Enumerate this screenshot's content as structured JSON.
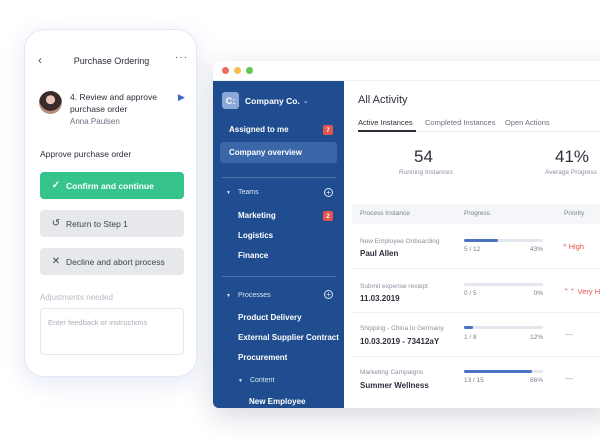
{
  "window": {
    "sidebar": {
      "company_logo": "C:",
      "company_name": "Company Co.",
      "caret_icon": "chevron-down-icon",
      "items": [
        {
          "label": "Assigned to me",
          "badge": "7"
        },
        {
          "label": "Company overview"
        }
      ],
      "teams": {
        "label": "Teams",
        "items": [
          {
            "label": "Marketing",
            "badge": "2"
          },
          {
            "label": "Logistics"
          },
          {
            "label": "Finance"
          }
        ]
      },
      "processes": {
        "label": "Processes",
        "items": [
          {
            "label": "Product Delivery"
          },
          {
            "label": "External Supplier Contract"
          },
          {
            "label": "Procurement"
          }
        ],
        "content": {
          "label": "Content",
          "items": [
            {
              "label": "New Employee"
            }
          ]
        }
      }
    },
    "main": {
      "title": "All Activity",
      "tabs": [
        {
          "label": "Active Instances"
        },
        {
          "label": "Completed Instances"
        },
        {
          "label": "Open Actions"
        }
      ],
      "kpis": [
        {
          "value": "54",
          "label": "Running Instances"
        },
        {
          "value": "41%",
          "label": "Average Progress"
        }
      ],
      "table": {
        "headers": [
          "Process Instance",
          "Progress",
          "Priority"
        ],
        "rows": [
          {
            "process": "New Employee Onboarding",
            "name": "Paul Allen",
            "count": "5 / 12",
            "percent": "43%",
            "progress": 0.43,
            "priority": "^ High"
          },
          {
            "process": "Submit expense receipt",
            "name": "11.03.2019",
            "count": "0 / 5",
            "percent": "0%",
            "progress": 0.0,
            "priority": "Very Hi"
          },
          {
            "process": "Shipping - China to Germany",
            "name": "10.03.2019 - 73412aY",
            "count": "1 / 8",
            "percent": "12%",
            "progress": 0.12,
            "priority": "—"
          },
          {
            "process": "Marketing Campaigns",
            "name": "Summer Wellness",
            "count": "13 / 15",
            "percent": "86%",
            "progress": 0.86,
            "priority": "—"
          }
        ]
      }
    }
  },
  "phone": {
    "title": "Purchase Ordering",
    "back_icon": "chevron-left-icon",
    "more_icon": "more-horizontal-icon",
    "step": "4.  Review and approve purchase order",
    "assignee": "Anna Paulsen",
    "section_label": "Approve purchase order",
    "buttons": {
      "confirm": "Confirm and continue",
      "return": "Return to Step 1",
      "decline": "Decline and abort process"
    },
    "adjustments_label": "Adjustments needed",
    "feedback_placeholder": "Enter feedback or instructions"
  },
  "colors": {
    "sidebar": "#1f4d8f",
    "accent_green": "#36c48c",
    "badge_red": "#e4534e",
    "progress_blue": "#4a73c4"
  }
}
